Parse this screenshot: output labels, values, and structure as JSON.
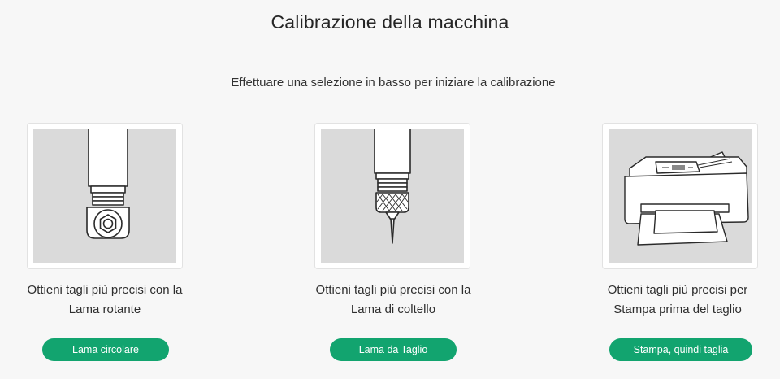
{
  "page": {
    "title": "Calibrazione della macchina",
    "subtitle": "Effettuare una selezione in basso per iniziare la calibrazione"
  },
  "options": [
    {
      "icon": "rotary-blade-icon",
      "desc_line1": "Ottieni tagli più precisi con la",
      "desc_line2": "Lama rotante",
      "button_label": "Lama circolare"
    },
    {
      "icon": "knife-blade-icon",
      "desc_line1": "Ottieni tagli più precisi con la",
      "desc_line2": "Lama di coltello",
      "button_label": "Lama da Taglio"
    },
    {
      "icon": "printer-icon",
      "desc_line1": "Ottieni tagli più precisi per",
      "desc_line2": "Stampa prima del taglio",
      "button_label": "Stampa, quindi taglia"
    }
  ],
  "colors": {
    "accent": "#12a46f",
    "background": "#f7f7f7",
    "card_image_bg": "#dadada"
  }
}
